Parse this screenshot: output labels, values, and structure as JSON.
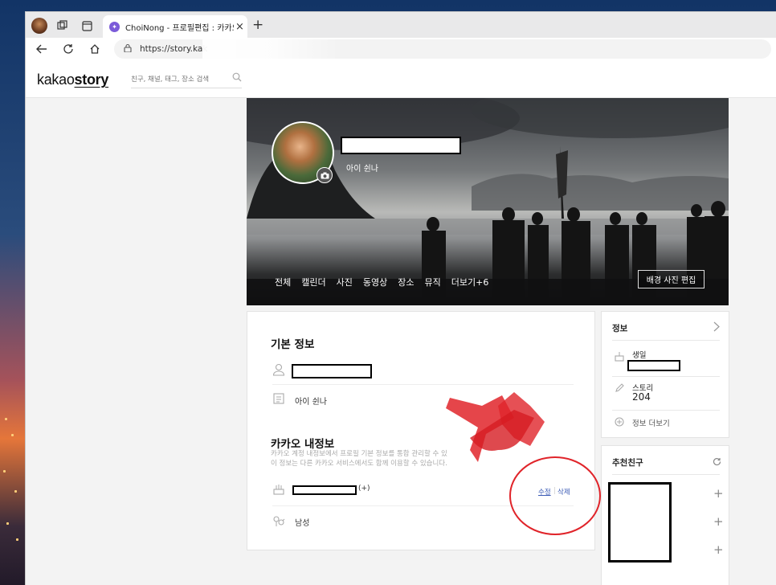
{
  "browser": {
    "tab_title": "ChoiNong - 프로필편집 : 카카오",
    "tab_close": "×",
    "new_tab": "+",
    "url": "https://story.kak"
  },
  "header": {
    "logo_kakao": "kakao",
    "logo_story": "story",
    "search_placeholder": "친구, 채널, 태그, 장소 검색"
  },
  "cover": {
    "status_message": "아이 쉰나",
    "tabs": [
      "전체",
      "캘린더",
      "사진",
      "동영상",
      "장소",
      "뮤직",
      "더보기+6"
    ],
    "edit_background_label": "배경 사진 편집"
  },
  "main": {
    "basic_info_title": "기본 정보",
    "status_message": "아이 쉰나",
    "kakao_info_title": "카카오 내정보",
    "kakao_info_desc_1": "카카오 계정 내정보에서 프로필 기본 정보를 통합 관리할 수 있",
    "kakao_info_desc_2": "이 정보는 다른 카카오 서비스에서도 함께 이용할 수 있습니다.",
    "birthday_suffix": "(+)",
    "edit_label": "수정",
    "separator": "|",
    "delete_label": "삭제",
    "gender": "남성"
  },
  "info_panel": {
    "title": "정보",
    "birthday_label": "생일",
    "story_label": "스토리",
    "story_count": "204",
    "more_info_label": "정보 더보기"
  },
  "friends_panel": {
    "title": "추천친구",
    "add_symbol": "+"
  },
  "colors": {
    "annotation_red": "#e0242a",
    "link_blue": "#3b5bb5"
  }
}
